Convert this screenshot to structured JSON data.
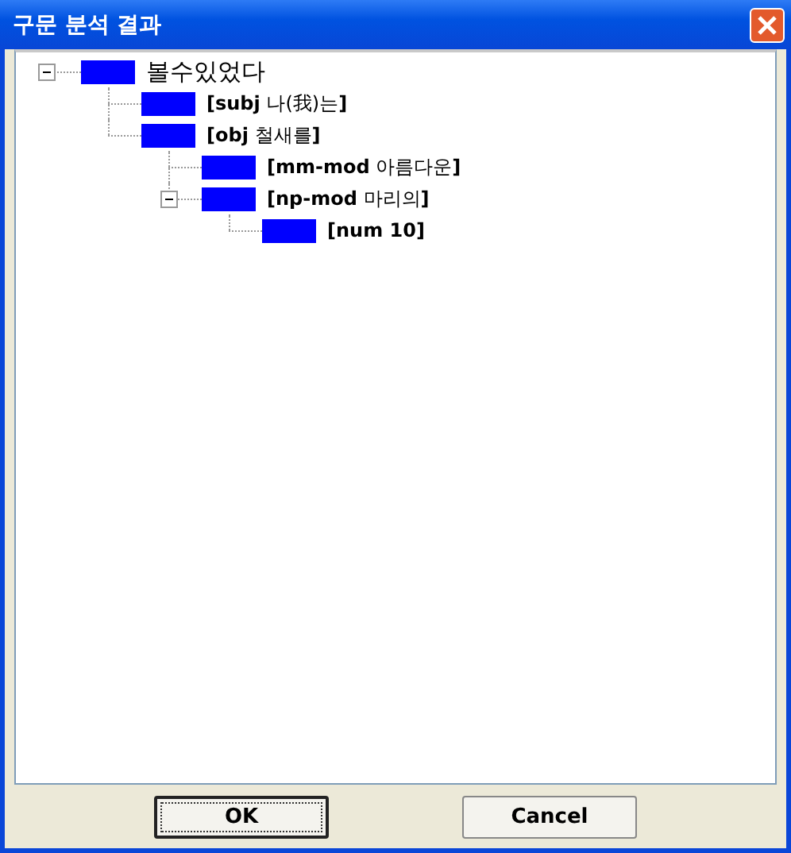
{
  "window": {
    "title": "구문 분석 결과"
  },
  "tree": [
    {
      "label": "볼수있었다",
      "expanded": true,
      "children": [
        {
          "label": "**[subj** 나(我)는**]**"
        },
        {
          "label": "**[obj** 철새를**]**",
          "children": [
            {
              "label": "**[mm-mod** 아름다운**]**"
            },
            {
              "label": "**[np-mod** 마리의**]**",
              "expanded": true,
              "children": [
                {
                  "label": "**[num 10]**"
                }
              ]
            }
          ]
        }
      ]
    }
  ],
  "buttons": [
    {
      "label": "OK",
      "selected": true
    },
    {
      "label": "Cancel",
      "selected": false
    }
  ]
}
